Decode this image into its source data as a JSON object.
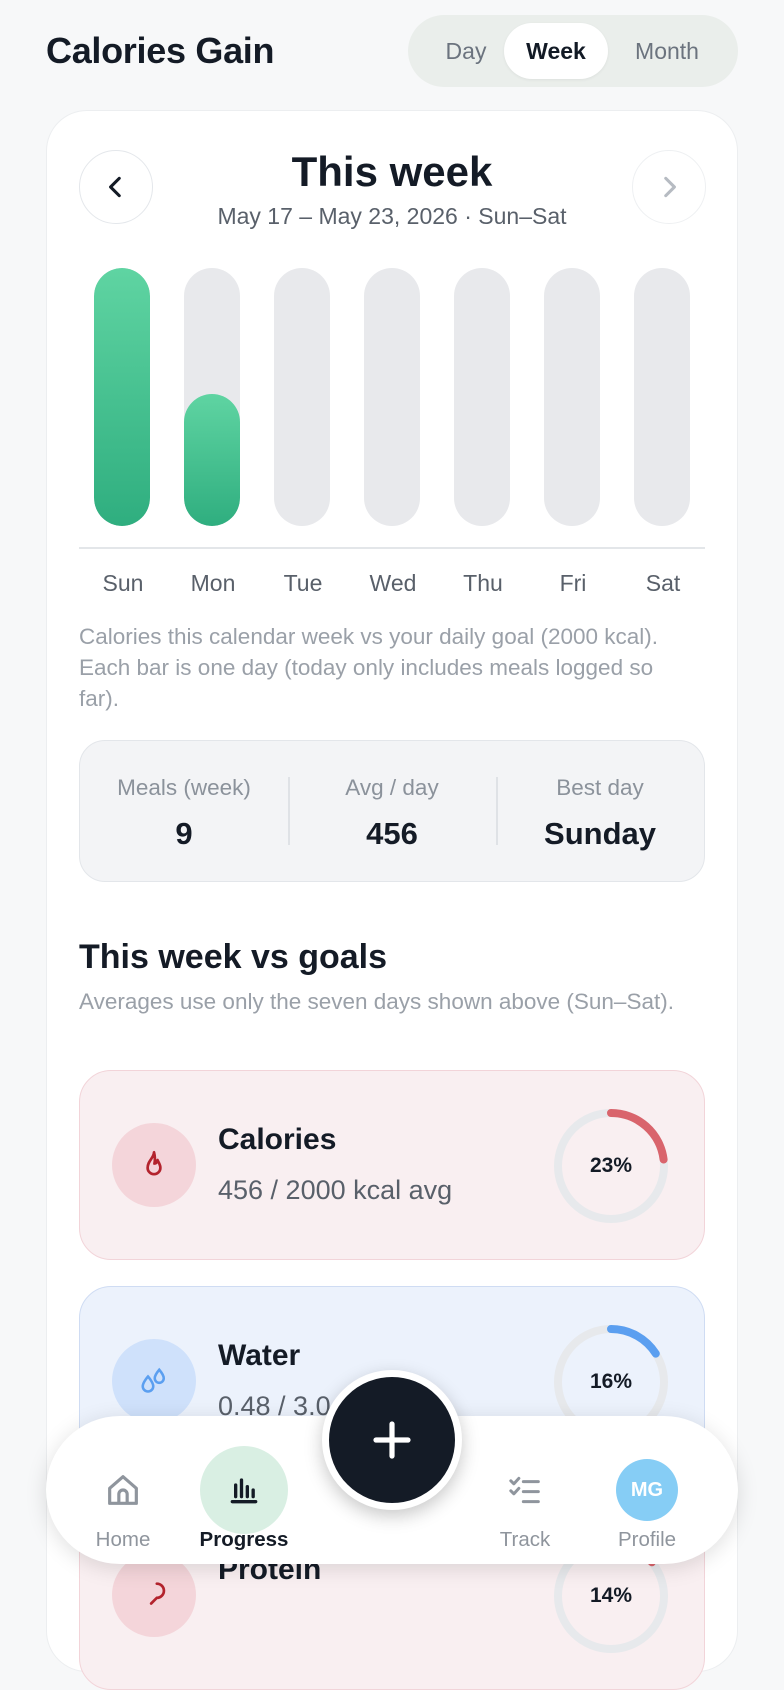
{
  "header": {
    "title": "Calories Gain",
    "segments": [
      "Day",
      "Week",
      "Month"
    ],
    "active_segment": "Week"
  },
  "week": {
    "title": "This week",
    "range": "May 17 – May 23, 2026 · Sun–Sat",
    "days": [
      "Sun",
      "Mon",
      "Tue",
      "Wed",
      "Thu",
      "Fri",
      "Sat"
    ],
    "fill_fraction": [
      1.0,
      0.51,
      0,
      0,
      0,
      0,
      0
    ],
    "note": "Calories this calendar week vs your daily goal (2000 kcal). Each bar is one day (today only includes meals logged so far)."
  },
  "stats": {
    "meals_label": "Meals (week)",
    "meals_value": "9",
    "avg_label": "Avg / day",
    "avg_value": "456",
    "best_label": "Best day",
    "best_value": "Sunday"
  },
  "goals": {
    "title": "This week vs goals",
    "subtitle": "Averages use only the seven days shown above (Sun–Sat).",
    "calories": {
      "name": "Calories",
      "detail": "456 / 2000 kcal avg",
      "percent_label": "23%",
      "percent": 23,
      "color": "#d9646c"
    },
    "water": {
      "name": "Water",
      "detail": "0.48 / 3.0",
      "percent_label": "16%",
      "percent": 16,
      "color": "#5b9ff0"
    },
    "protein": {
      "name": "Protein",
      "percent_label": "14%",
      "percent": 14,
      "color": "#d9646c"
    }
  },
  "nav": {
    "home": "Home",
    "progress": "Progress",
    "track": "Track",
    "profile": "Profile",
    "avatar_initials": "MG"
  },
  "colors": {
    "bar_fill": "#3cbf8b",
    "bar_track": "#e8e9ec",
    "accent_dark": "#141b26"
  }
}
